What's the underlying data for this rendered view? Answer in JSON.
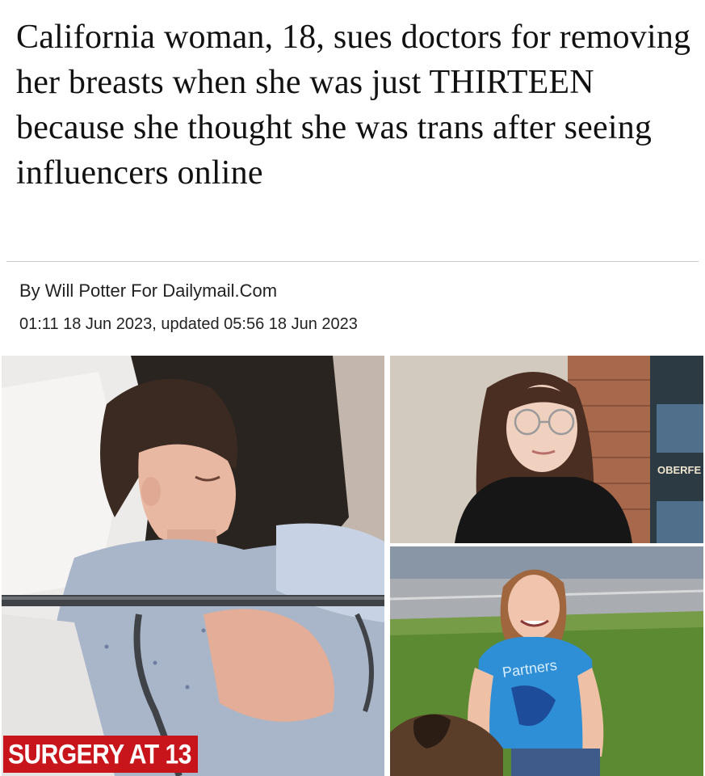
{
  "article": {
    "headline": "California woman, 18, sues doctors for removing her breasts when she was just THIRTEEN because she thought she was trans after seeing influencers online",
    "byline": "By Will Potter For Dailymail.Com",
    "dateline": "01:11  18 Jun 2023, updated 05:56  18 Jun 2023"
  },
  "photos": {
    "main_caption": "SURGERY AT 13",
    "shirt_text": "Partners",
    "shop_sign_text": "OBERFE"
  },
  "colors": {
    "badge": "#c8151b",
    "text": "#111111",
    "divider": "#c9c9c9"
  }
}
